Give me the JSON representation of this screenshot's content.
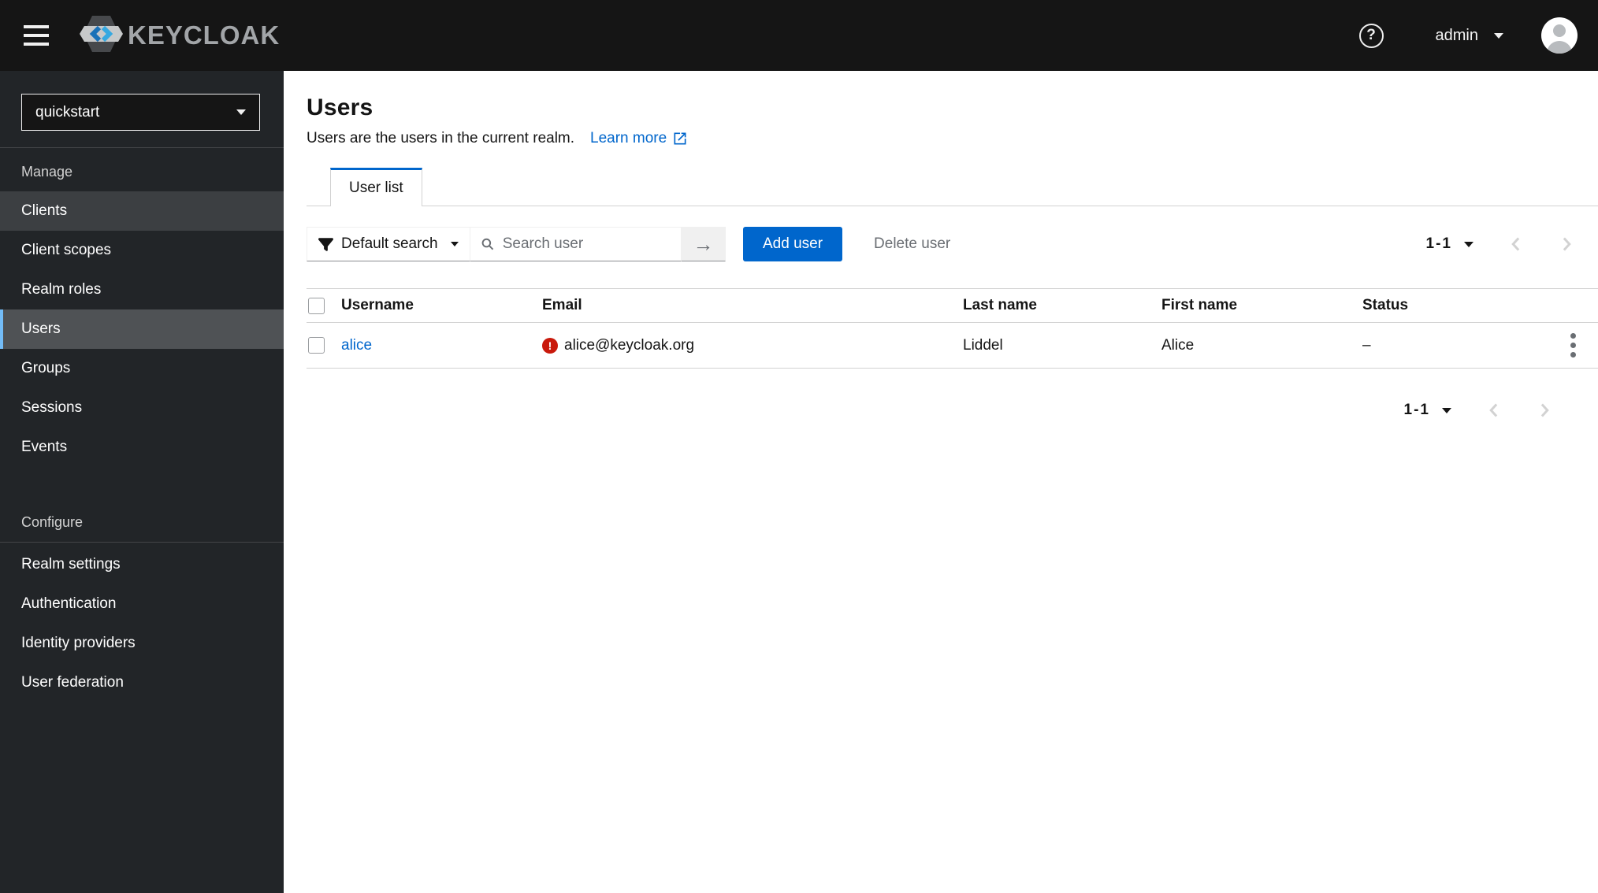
{
  "header": {
    "brand": "KEYCLOAK",
    "username": "admin"
  },
  "sidebar": {
    "realm_selector": "quickstart",
    "sections": [
      {
        "label": "Manage",
        "items": [
          {
            "label": "Clients"
          },
          {
            "label": "Client scopes"
          },
          {
            "label": "Realm roles"
          },
          {
            "label": "Users"
          },
          {
            "label": "Groups"
          },
          {
            "label": "Sessions"
          },
          {
            "label": "Events"
          }
        ]
      },
      {
        "label": "Configure",
        "items": [
          {
            "label": "Realm settings"
          },
          {
            "label": "Authentication"
          },
          {
            "label": "Identity providers"
          },
          {
            "label": "User federation"
          }
        ]
      }
    ]
  },
  "page": {
    "title": "Users",
    "subtitle": "Users are the users in the current realm.",
    "learn_more_label": "Learn more",
    "active_tab": "User list"
  },
  "toolbar": {
    "search_type_label": "Default search",
    "search_placeholder": "Search user",
    "add_user_label": "Add user",
    "delete_user_label": "Delete user",
    "pagination_range": "1-1"
  },
  "table": {
    "headers": {
      "username": "Username",
      "email": "Email",
      "last_name": "Last name",
      "first_name": "First name",
      "status": "Status"
    },
    "rows": [
      {
        "username": "alice",
        "email": "alice@keycloak.org",
        "email_warning": "!",
        "last_name": "Liddel",
        "first_name": "Alice",
        "status": "–"
      }
    ]
  },
  "footer": {
    "pagination_range": "1-1"
  },
  "colors": {
    "accent": "#0066cc",
    "danger": "#c9190b",
    "masthead_bg": "#151515",
    "sidebar_bg": "#222528",
    "nav_current_bg": "#4f5255",
    "nav_current_indicator": "#73bcf7",
    "disabled_text": "#6a6e73",
    "border": "#d2d2d2"
  }
}
